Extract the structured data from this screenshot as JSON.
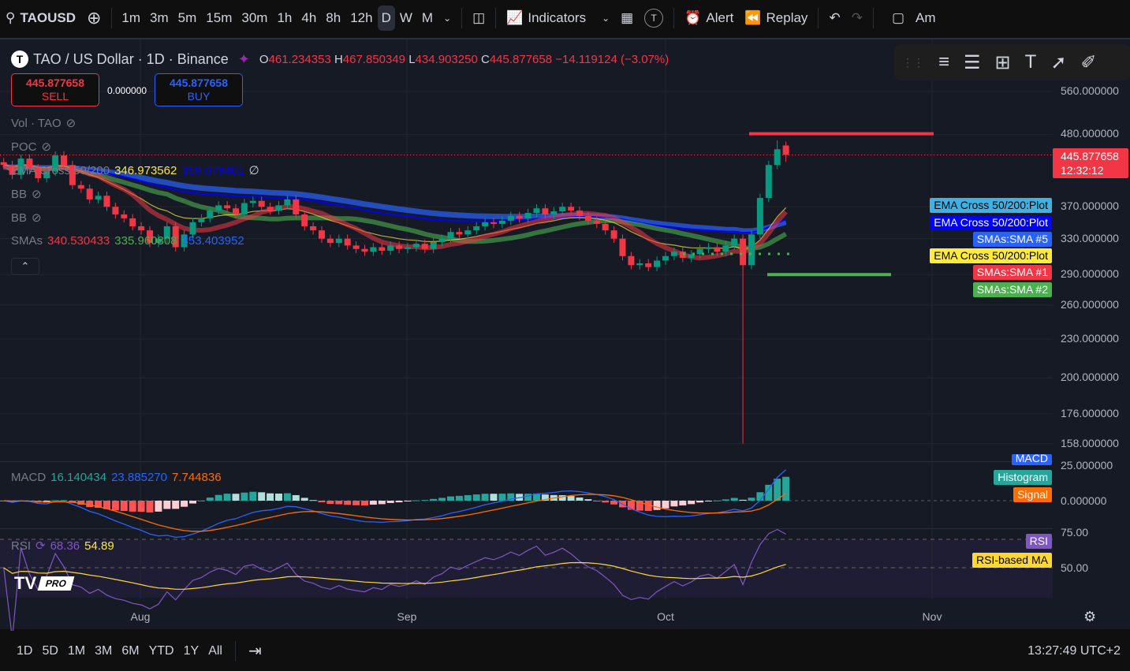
{
  "toolbar": {
    "symbol": "TAOUSD",
    "intervals": [
      "1m",
      "3m",
      "5m",
      "15m",
      "30m",
      "1h",
      "4h",
      "8h",
      "12h",
      "D",
      "W",
      "M"
    ],
    "active_interval": "D",
    "indicators": "Indicators",
    "avatar": "T",
    "alert": "Alert",
    "replay": "Replay",
    "account": "Am"
  },
  "header": {
    "logo": "T",
    "title": "TAO / US Dollar · 1D · Binance",
    "o_label": "O",
    "o": "461.234353",
    "h_label": "H",
    "h": "467.850349",
    "l_label": "L",
    "l": "434.903250",
    "c_label": "C",
    "c": "445.877658",
    "change": "−14.119124 (−3.07%)"
  },
  "trade": {
    "sell_price": "445.877658",
    "sell": "SELL",
    "spread": "0.000000",
    "buy_price": "445.877658",
    "buy": "BUY"
  },
  "indicators": {
    "vol": "Vol · TAO",
    "poc": "POC",
    "ema_cross": "EMA Cross 50/200",
    "ema_v1": "346.973562",
    "ema_v2": "359.079401",
    "bb1": "BB",
    "bb2": "BB",
    "smas": "SMAs",
    "sma_v1": "340.530433",
    "sma_v2": "335.960808",
    "sma_v3": "353.403952",
    "macd": "MACD",
    "macd_v1": "16.140434",
    "macd_v2": "23.885270",
    "macd_v3": "7.744836",
    "rsi": "RSI",
    "rsi_v1": "68.36",
    "rsi_v2": "54.89"
  },
  "price_axis": [
    "560.000000",
    "480.000000",
    "370.000000",
    "330.000000",
    "290.000000",
    "260.000000",
    "230.000000",
    "200.000000",
    "176.000000",
    "158.000000"
  ],
  "last_price": {
    "price": "445.877658",
    "countdown": "12:32:12"
  },
  "tags": [
    {
      "text": "EMA Cross 50/200:Plot",
      "bg": "#3fb1e3",
      "fg": "#000"
    },
    {
      "text": "EMA Cross 50/200:Plot",
      "bg": "#0000ff",
      "fg": "#fff"
    },
    {
      "text": "SMAs:SMA #5",
      "bg": "#2962ff",
      "fg": "#fff"
    },
    {
      "text": "EMA Cross 50/200:Plot",
      "bg": "#ffeb3b",
      "fg": "#000"
    },
    {
      "text": "SMAs:SMA #1",
      "bg": "#f23645",
      "fg": "#fff"
    },
    {
      "text": "SMAs:SMA #2",
      "bg": "#4caf50",
      "fg": "#fff"
    }
  ],
  "macd_axis": [
    "25.000000",
    "0.000000"
  ],
  "macd_tags": {
    "macd": "MACD",
    "hist": "Histogram",
    "signal": "Signal"
  },
  "rsi_axis": [
    "75.00",
    "50.00"
  ],
  "rsi_tags": {
    "rsi": "RSI",
    "ma": "RSI-based MA"
  },
  "time_axis": [
    "Aug",
    "Sep",
    "Oct",
    "Nov"
  ],
  "watermark": "PRO",
  "bottom": {
    "ranges": [
      "1D",
      "5D",
      "1M",
      "3M",
      "6M",
      "YTD",
      "1Y",
      "All"
    ],
    "clock": "13:27:49 UTC+2"
  },
  "colors": {
    "up": "#089981",
    "down": "#f23645",
    "bg": "#161a25"
  },
  "chart_data": {
    "type": "candlestick",
    "start": "Jul 16",
    "scale": "log",
    "closes": [
      430,
      415,
      440,
      425,
      410,
      420,
      445,
      430,
      400,
      395,
      380,
      385,
      370,
      360,
      355,
      345,
      340,
      325,
      330,
      345,
      320,
      335,
      350,
      355,
      365,
      372,
      368,
      360,
      375,
      378,
      370,
      365,
      372,
      380,
      360,
      345,
      340,
      330,
      325,
      330,
      322,
      318,
      315,
      320,
      316,
      322,
      318,
      320,
      324,
      318,
      326,
      330,
      338,
      335,
      340,
      345,
      350,
      348,
      352,
      358,
      355,
      362,
      368,
      360,
      364,
      370,
      365,
      358,
      352,
      348,
      340,
      330,
      310,
      300,
      302,
      298,
      305,
      310,
      315,
      308,
      312,
      318,
      320,
      315,
      322,
      330,
      300,
      335,
      382,
      430,
      455,
      445.877658
    ],
    "special": {
      "86": {
        "low": 158
      },
      "90": {
        "high": 470
      },
      "91": {
        "open": 461.234353,
        "high": 467.850349,
        "low": 434.90325,
        "close": 445.877658
      }
    },
    "resistance": 481,
    "support": 290
  }
}
